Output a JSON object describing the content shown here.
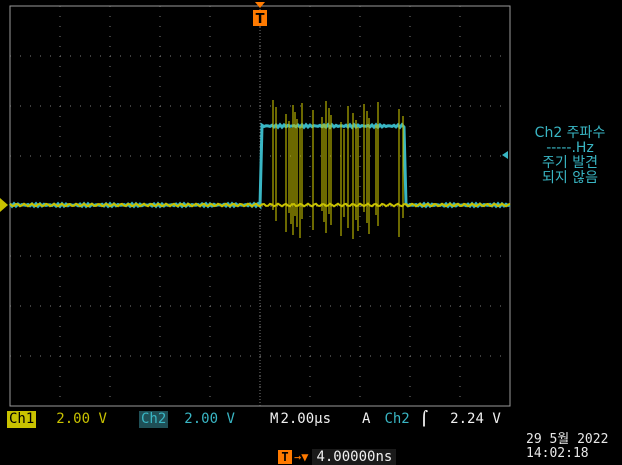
{
  "colors": {
    "ch1": "#c9c200",
    "ch2": "#39b6c4",
    "trigger": "#ff7a00",
    "grid": "#7a7a7a",
    "frame": "#9a9a9a"
  },
  "side_panel": {
    "line1": "Ch2 주파수",
    "line2": "-----.Hz",
    "line3": "주기 발견",
    "line4": "되지 않음"
  },
  "status_bar": {
    "ch1_label": "Ch1",
    "ch1_scale": "2.00 V",
    "ch2_label": "Ch2",
    "ch2_scale": "2.00 V",
    "timebase_prefix": "M",
    "timebase": "2.00µs",
    "trigger_mode": "A",
    "trigger_source": "Ch2",
    "trigger_slope_icon": "rising-edge-icon",
    "trigger_slope_glyph": "⌠",
    "trigger_level": "2.24 V"
  },
  "datetime": {
    "date": "29 5월  2022",
    "time": "14:02:18"
  },
  "trigger_position": {
    "badge": "T",
    "arrow": "→▼",
    "delay": "4.00000ns"
  },
  "markers": {
    "trigger_marker": "T",
    "ch1_ground_marker": "1",
    "ch2_level_marker": "◂"
  }
}
